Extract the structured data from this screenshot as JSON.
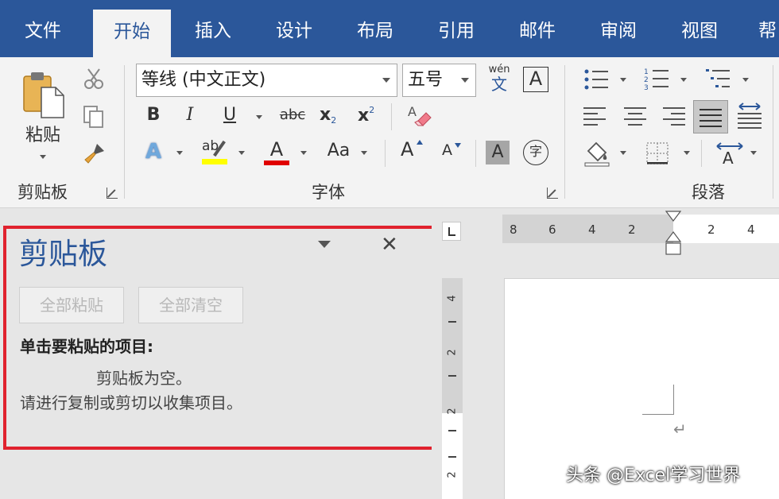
{
  "tabs": [
    "文件",
    "开始",
    "插入",
    "设计",
    "布局",
    "引用",
    "邮件",
    "审阅",
    "视图",
    "帮"
  ],
  "active_tab": "开始",
  "ribbon": {
    "clipboard_group": {
      "paste_label": "粘贴",
      "group_label": "剪贴板"
    },
    "font_group": {
      "font_name": "等线 (中文正文)",
      "font_size": "五号",
      "phonetic_label": "wén",
      "phonetic_char": "文",
      "char_border_label": "A",
      "bold": "B",
      "italic": "I",
      "underline": "U",
      "strikethrough": "abc",
      "subscript": "x",
      "subscript_mark": "2",
      "superscript": "x",
      "superscript_mark": "2",
      "text_effects": "A",
      "highlight": "ab",
      "font_color": "A",
      "change_case": "Aa",
      "grow_font": "A",
      "shrink_font": "A",
      "char_shading": "A",
      "enclose_char": "字",
      "group_label": "字体"
    },
    "paragraph_group": {
      "group_label": "段落"
    }
  },
  "clipboard_pane": {
    "title": "剪贴板",
    "paste_all": "全部粘贴",
    "clear_all": "全部清空",
    "instruction": "单击要粘贴的项目:",
    "empty_msg": "剪贴板为空。",
    "hint": "请进行复制或剪切以收集项目。"
  },
  "ruler": {
    "horizontal": [
      "8",
      "6",
      "4",
      "2",
      "2",
      "4"
    ],
    "vertical": [
      "4",
      "2",
      "2",
      "2"
    ]
  },
  "watermark": "头条 @Excel学习世界",
  "colors": {
    "brand": "#2b579a",
    "highlight_border": "#e0222e",
    "highlight_yellow": "#ffff00",
    "font_red": "#e00000"
  }
}
